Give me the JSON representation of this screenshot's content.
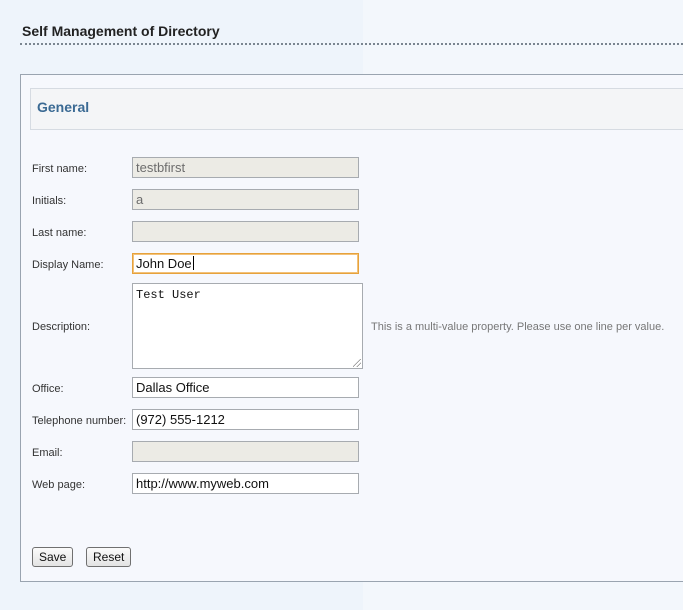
{
  "page": {
    "title": "Self Management of Directory"
  },
  "section": {
    "title": "General"
  },
  "fields": [
    {
      "label": "First name:",
      "value": "testbfirst",
      "disabled": true
    },
    {
      "label": "Initials:",
      "value": "a",
      "disabled": true
    },
    {
      "label": "Last name:",
      "value": "",
      "disabled": true
    },
    {
      "label": "Display Name:",
      "value": "John Doe",
      "disabled": false,
      "focused": true
    },
    {
      "label": "Office:",
      "value": "Dallas Office",
      "disabled": false
    },
    {
      "label": "Telephone number:",
      "value": "(972) 555-1212",
      "disabled": false
    },
    {
      "label": "Email:",
      "value": "",
      "disabled": true
    },
    {
      "label": "Web page:",
      "value": "http://www.myweb.com",
      "disabled": false
    }
  ],
  "description": {
    "label": "Description:",
    "value": "Test User",
    "hint": "This is a multi-value property. Please use one line per value."
  },
  "buttons": {
    "save": "Save",
    "reset": "Reset"
  },
  "colors": {
    "section_title": "#3b6a94",
    "focus_border": "#e6a23c",
    "disabled_bg": "#ecebe5"
  }
}
